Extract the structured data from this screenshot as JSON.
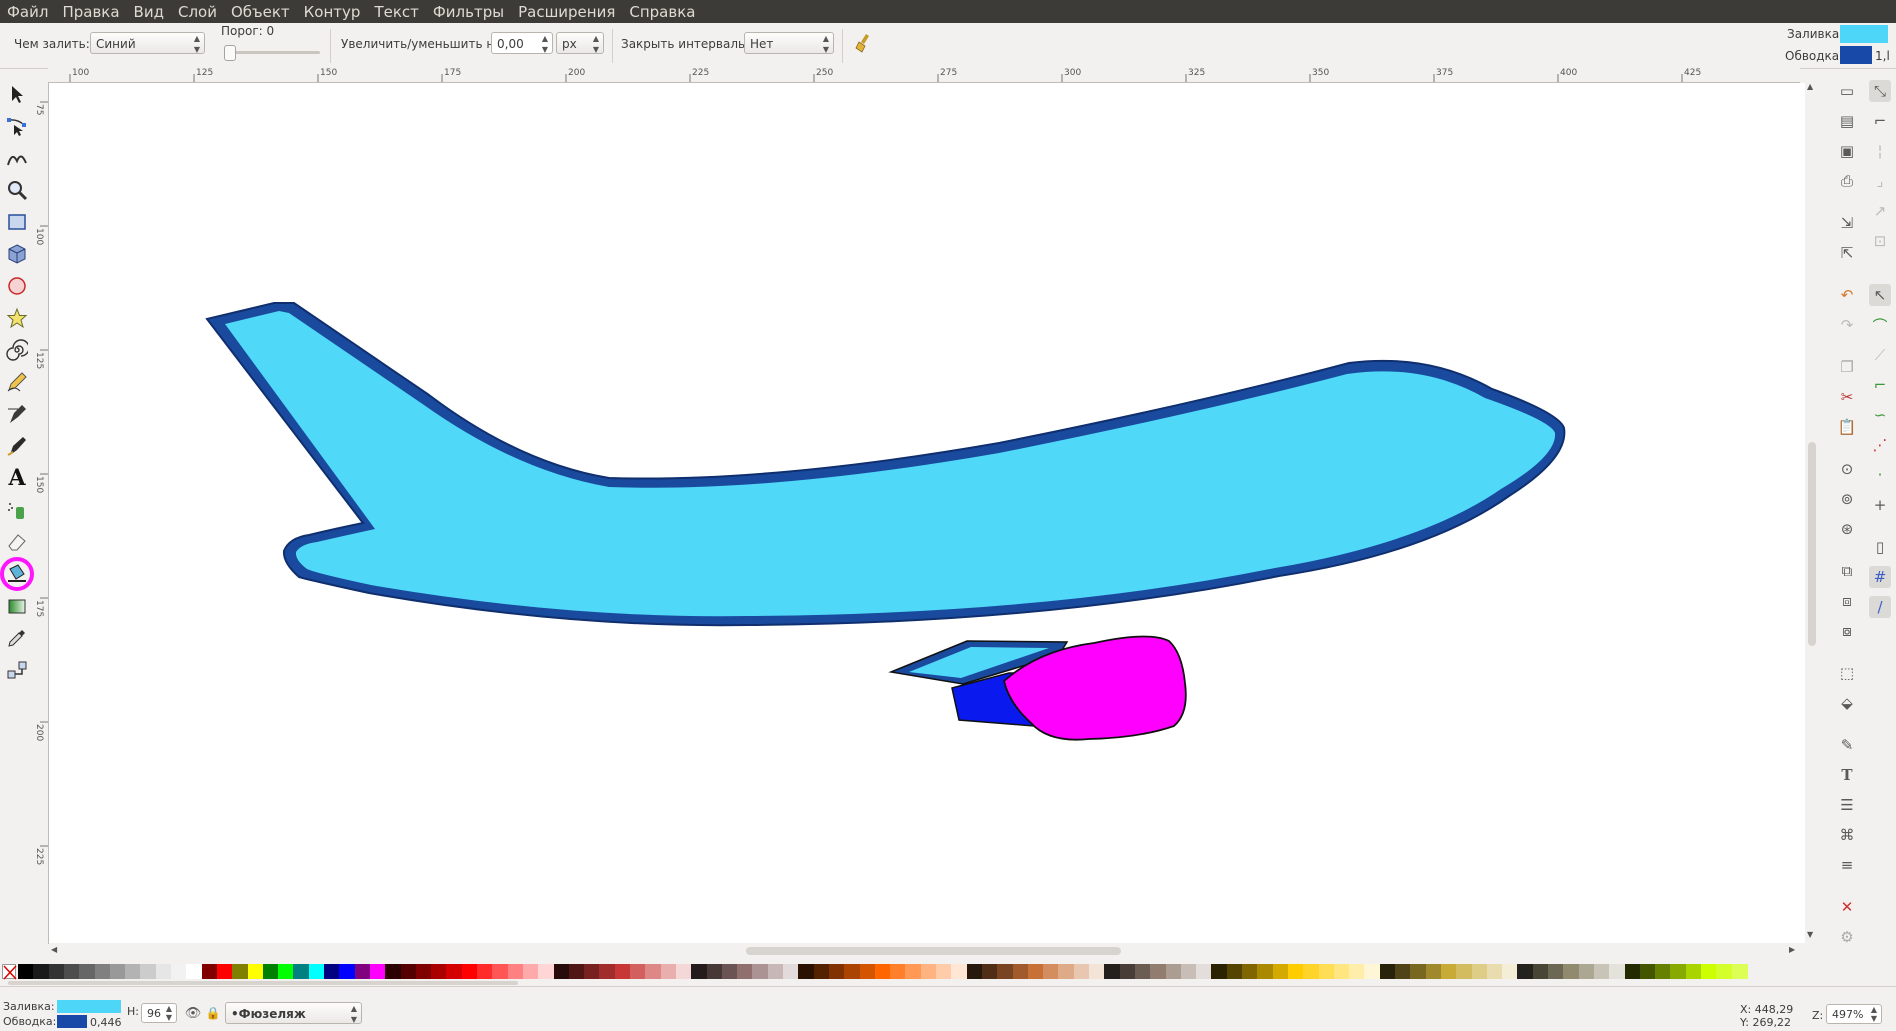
{
  "menu": [
    "Файл",
    "Правка",
    "Вид",
    "Слой",
    "Объект",
    "Контур",
    "Текст",
    "Фильтры",
    "Расширения",
    "Справка"
  ],
  "tool_controls": {
    "fill_by_label": "Чем залить:",
    "fill_by_value": "Синий",
    "threshold_label": "Порог: 0",
    "grow_label": "Увеличить/уменьшить на:",
    "grow_value": "0,00",
    "grow_unit": "px",
    "close_gaps_label": "Закрыть интервалы:",
    "close_gaps_value": "Нет"
  },
  "style_indicator": {
    "fill_label": "Заливка:",
    "stroke_label": "Обводка:",
    "stroke_width": "1,l",
    "fill_color": "#4dd6f7",
    "stroke_color": "#1848a8"
  },
  "ruler_top": [
    "100",
    "125",
    "150",
    "175",
    "200",
    "225",
    "250",
    "275",
    "300",
    "325",
    "350",
    "375",
    "400",
    "425"
  ],
  "ruler_left": [
    "75",
    "100",
    "125",
    "150",
    "175",
    "200",
    "225"
  ],
  "toolbox": [
    "selector-tool",
    "node-tool",
    "tweak-tool",
    "zoom-tool",
    "rect-tool",
    "3dbox-tool",
    "ellipse-tool",
    "star-tool",
    "spiral-tool",
    "pencil-tool",
    "pen-tool",
    "calligraphy-tool",
    "text-tool",
    "spray-tool",
    "eraser-tool",
    "paint-bucket-tool",
    "gradient-tool",
    "dropper-tool",
    "connector-tool"
  ],
  "active_tool": "paint-bucket-tool",
  "canvas": {
    "fuselage_fill": "#50d8f8",
    "fuselage_stroke": "#1a4a9e",
    "engine_fill": "#ff00ff",
    "engine_body_fill": "#0a1aef",
    "pylon_fill": "#50d8f8"
  },
  "palette": [
    "#000000",
    "#1a1a1a",
    "#333333",
    "#4d4d4d",
    "#666666",
    "#808080",
    "#999999",
    "#b3b3b3",
    "#cccccc",
    "#e6e6e6",
    "#f2f2f2",
    "#ffffff",
    "#800000",
    "#ff0000",
    "#808000",
    "#ffff00",
    "#008000",
    "#00ff00",
    "#008080",
    "#00ffff",
    "#000080",
    "#0000ff",
    "#800080",
    "#ff00ff",
    "#2b0000",
    "#550000",
    "#800000",
    "#aa0000",
    "#d40000",
    "#ff0000",
    "#ff2a2a",
    "#ff5555",
    "#ff8080",
    "#ffaaaa",
    "#ffd5d5",
    "#280b0b",
    "#501616",
    "#782121",
    "#a02c2c",
    "#c83737",
    "#d35f5f",
    "#de8787",
    "#e9afaf",
    "#f4d7d7",
    "#241c1c",
    "#483737",
    "#6c5353",
    "#916f6f",
    "#ac9393",
    "#c8b7b7",
    "#e3dbdb",
    "#2b1100",
    "#552200",
    "#803300",
    "#aa4400",
    "#d45500",
    "#ff6600",
    "#ff7f2a",
    "#ff9955",
    "#ffb380",
    "#ffccaa",
    "#ffe6d5",
    "#28170b",
    "#502d16",
    "#784421",
    "#a05a2c",
    "#c87137",
    "#d38d5f",
    "#deaa87",
    "#e9c6af",
    "#f4e3d7",
    "#241f1c",
    "#483e37",
    "#6c5d53",
    "#917c6f",
    "#ac9d93",
    "#c8beb7",
    "#e3dedb",
    "#2b2200",
    "#554400",
    "#806600",
    "#aa8800",
    "#d4aa00",
    "#ffcc00",
    "#ffd42a",
    "#ffdd55",
    "#ffe680",
    "#ffeeaa",
    "#fff6d5",
    "#28220b",
    "#504416",
    "#786721",
    "#a0892c",
    "#c8ab37",
    "#d3bc5f",
    "#decd87",
    "#e9ddaf",
    "#f4eed7",
    "#24221c",
    "#484537",
    "#6c6753",
    "#918a6f",
    "#aca793",
    "#c8c4b7",
    "#e3e2db",
    "#222b00",
    "#445500",
    "#668000",
    "#88aa00",
    "#aad400",
    "#ccff00",
    "#d4ff2a",
    "#ddff55"
  ],
  "status": {
    "fill_label": "Заливка:",
    "stroke_label": "Обводка:",
    "stroke_width": "0,446",
    "fill_color": "#4dd6f7",
    "stroke_color": "#1848a8",
    "h_label": "H:",
    "h_value": "96",
    "layer": "•Фюзеляж",
    "x_coord": "X: 448,29",
    "y_coord": "Y: 269,22",
    "zoom_label": "Z:",
    "zoom_value": "497%"
  }
}
